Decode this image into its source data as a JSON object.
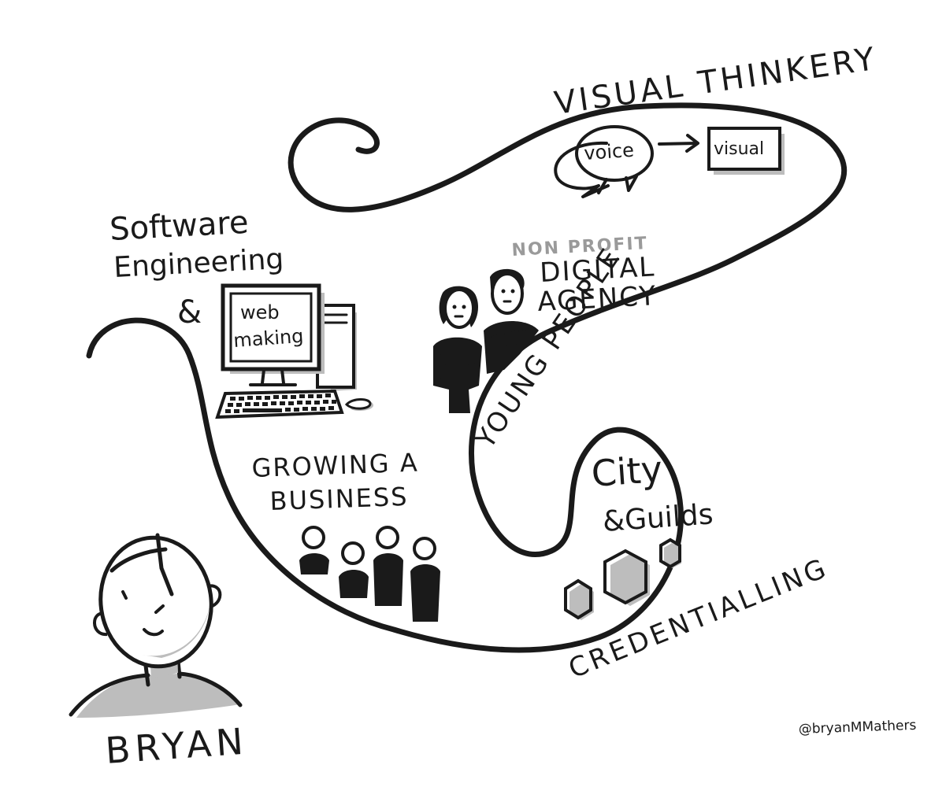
{
  "labels": {
    "visual_thinkery": "VISUAL THINKERY",
    "voice": "voice",
    "visual": "visual",
    "non_profit": "NON PROFIT",
    "digital": "DIGITAL",
    "agency": "AGENCY",
    "young_people": "YOUNG PEOPLE",
    "software": "Software",
    "engineering": "Engineering",
    "ampersand": "&",
    "web": "web",
    "making": "making",
    "growing": "GROWING A",
    "business": "BUSINESS",
    "city": "City",
    "and_guilds": "&Guilds",
    "credentialling": "CREDENTIALLING",
    "bryan": "BRYAN",
    "signature": "@bryanMMathers"
  },
  "colors": {
    "ink": "#1a1a1a",
    "shadow": "#bdbdbd",
    "grey_text": "#9a9a9a",
    "paper": "#ffffff"
  },
  "icons": {
    "person": "bryan-portrait",
    "computer": "desktop-computer",
    "speech": "speech-bubbles",
    "screen": "visual-screen",
    "team": "team-of-people",
    "young_people": "two-young-people",
    "badges": "hexagon-badges"
  }
}
